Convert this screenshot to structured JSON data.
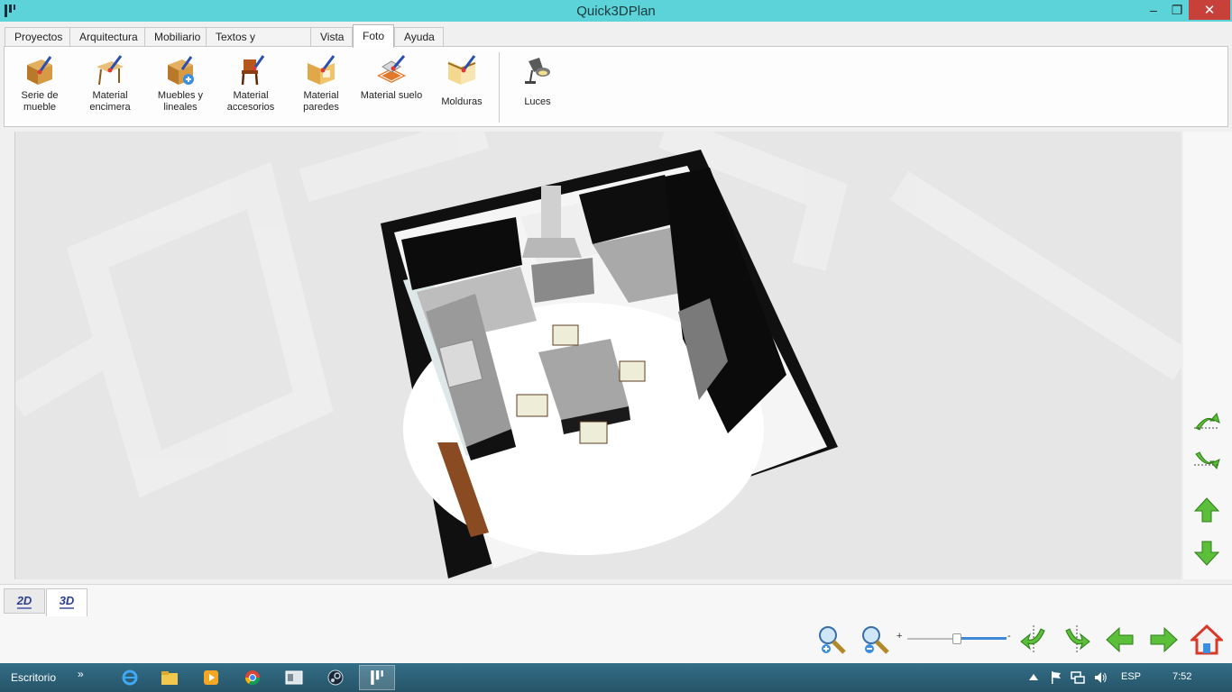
{
  "window": {
    "title": "Quick3DPlan",
    "min_glyph": "–",
    "max_glyph": "❐",
    "close_glyph": "✕"
  },
  "tabs": [
    {
      "label": "Proyectos"
    },
    {
      "label": "Arquitectura"
    },
    {
      "label": "Mobiliario"
    },
    {
      "label": "Textos y contornos"
    },
    {
      "label": "Vista"
    },
    {
      "label": "Foto",
      "active": true
    },
    {
      "label": "Ayuda"
    }
  ],
  "ribbon": {
    "tools": [
      {
        "label": "Serie de mueble",
        "icon": "cabinet-brush-icon"
      },
      {
        "label": "Material encimera",
        "icon": "countertop-brush-icon"
      },
      {
        "label": "Muebles y lineales",
        "icon": "cabinet-add-icon"
      },
      {
        "label": "Material accesorios",
        "icon": "chair-brush-icon"
      },
      {
        "label": "Material paredes",
        "icon": "wall-brush-icon"
      },
      {
        "label": "Material suelo",
        "icon": "floor-brush-icon"
      },
      {
        "label": "Molduras",
        "icon": "molding-brush-icon"
      },
      {
        "label": "Luces",
        "icon": "lamp-icon"
      }
    ]
  },
  "view_tabs": [
    {
      "label": "2D"
    },
    {
      "label": "3D",
      "active": true
    }
  ],
  "zoom_slider": {
    "plus": "+",
    "minus": "-",
    "level": 0.5
  },
  "taskbar": {
    "desktop_label": "Escritorio",
    "chevron": "»",
    "language": "ESP",
    "time": "7:52"
  },
  "colors": {
    "titlebar": "#5cd3d9",
    "accent_green": "#5bbf3a",
    "taskbar": "#2b5f78"
  }
}
